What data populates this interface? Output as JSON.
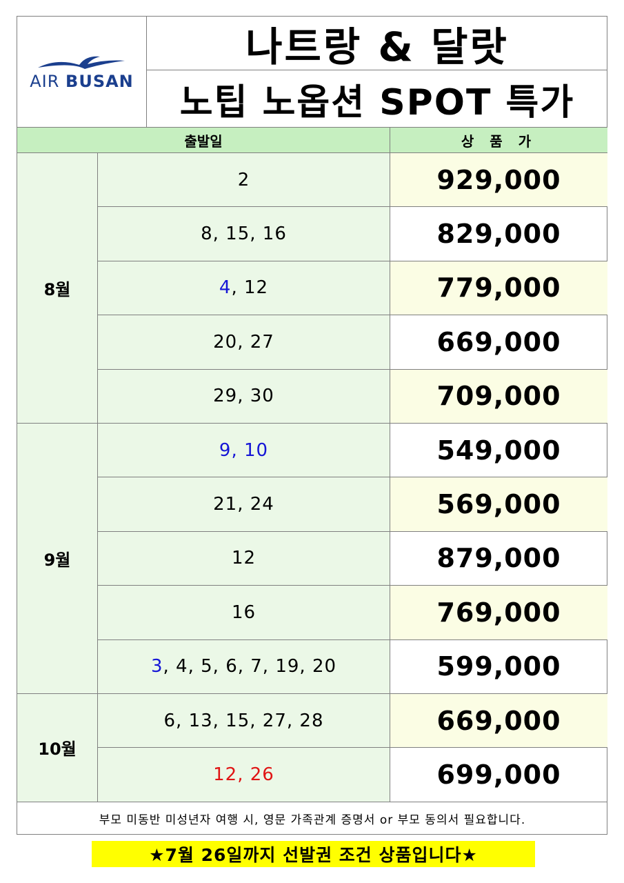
{
  "logo": {
    "air": "AIR",
    "busan": "BUSAN"
  },
  "title": {
    "line1": "나트랑 & 달랏",
    "line2": "노팁 노옵션 SPOT 특가"
  },
  "header": {
    "date": "출발일",
    "price": "상 품 가"
  },
  "months": [
    {
      "label": "8월",
      "rows": 5
    },
    {
      "label": "9월",
      "rows": 5
    },
    {
      "label": "10월",
      "rows": 2
    }
  ],
  "rows": [
    {
      "parts": [
        {
          "t": "2",
          "c": ""
        }
      ],
      "price": "929,000",
      "hl": true
    },
    {
      "parts": [
        {
          "t": "8, 15, 16",
          "c": ""
        }
      ],
      "price": "829,000",
      "hl": false
    },
    {
      "parts": [
        {
          "t": "4",
          "c": "blue"
        },
        {
          "t": ", 12",
          "c": ""
        }
      ],
      "price": "779,000",
      "hl": true
    },
    {
      "parts": [
        {
          "t": "20, 27",
          "c": ""
        }
      ],
      "price": "669,000",
      "hl": false
    },
    {
      "parts": [
        {
          "t": "29, 30",
          "c": ""
        }
      ],
      "price": "709,000",
      "hl": true
    },
    {
      "parts": [
        {
          "t": "9, 10",
          "c": "blue"
        }
      ],
      "price": "549,000",
      "hl": false
    },
    {
      "parts": [
        {
          "t": "21, 24",
          "c": ""
        }
      ],
      "price": "569,000",
      "hl": true
    },
    {
      "parts": [
        {
          "t": "12",
          "c": ""
        }
      ],
      "price": "879,000",
      "hl": false
    },
    {
      "parts": [
        {
          "t": "16",
          "c": ""
        }
      ],
      "price": "769,000",
      "hl": true
    },
    {
      "parts": [
        {
          "t": "3",
          "c": "blue"
        },
        {
          "t": ", 4, 5, 6, 7, 19, 20",
          "c": ""
        }
      ],
      "price": "599,000",
      "hl": false
    },
    {
      "parts": [
        {
          "t": "6, 13, 15, 27, 28",
          "c": ""
        }
      ],
      "price": "669,000",
      "hl": true
    },
    {
      "parts": [
        {
          "t": "12, 26",
          "c": "red"
        }
      ],
      "price": "699,000",
      "hl": false
    }
  ],
  "note": "부모 미동반 미성년자 여행 시, 영문 가족관계 증명서 or 부모 동의서 필요합니다.",
  "banner": "★7월 26일까지 선발권 조건 상품입니다★",
  "colors": {
    "header_bg": "#c6efc0",
    "date_bg": "#ebf8e7",
    "price_highlight": "#fbfde4",
    "blue": "#1515d6",
    "red": "#e01515",
    "banner_bg": "#ffff00",
    "logo": "#1b3f8e"
  }
}
